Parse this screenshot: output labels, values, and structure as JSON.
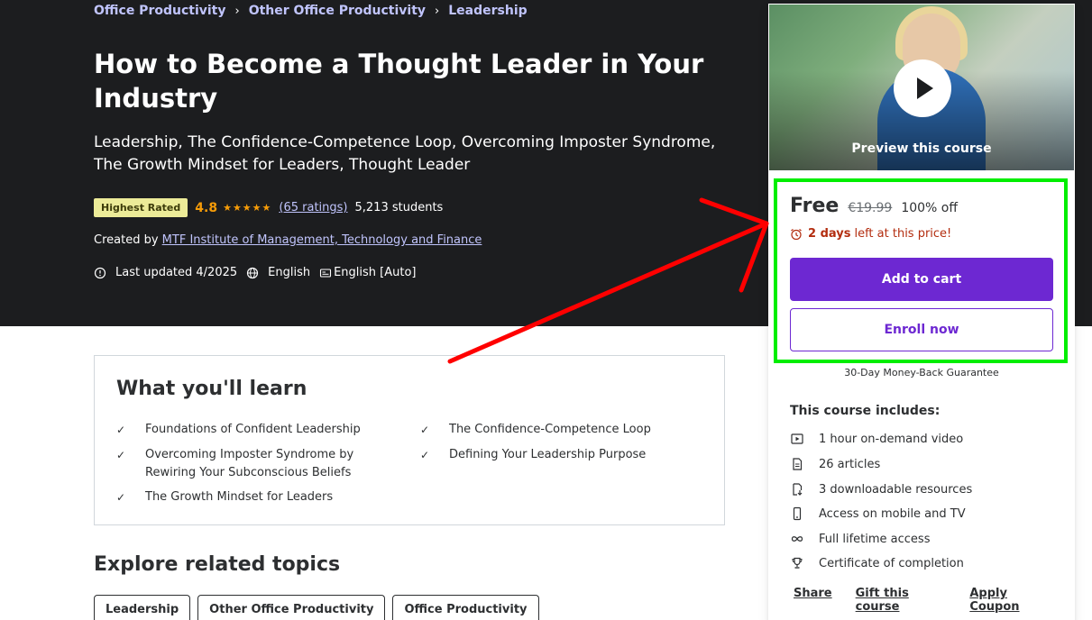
{
  "breadcrumbs": [
    "Office Productivity",
    "Other Office Productivity",
    "Leadership"
  ],
  "course": {
    "title": "How to Become a Thought Leader in Your Industry",
    "subtitle": "Leadership, The Confidence-Competence Loop, Overcoming Imposter Syndrome, The Growth Mindset for Leaders, Thought Leader",
    "badge": "Highest Rated",
    "rating": "4.8",
    "stars": 4.8,
    "ratings_count": "(65 ratings)",
    "students": "5,213 students",
    "created_by_label": "Created by",
    "creator": "MTF Institute of Management, Technology and Finance",
    "last_updated": "Last updated 4/2025",
    "language": "English",
    "captions": "English [Auto]"
  },
  "learn": {
    "heading": "What you'll learn",
    "items": [
      "Foundations of Confident Leadership",
      "The Confidence-Competence Loop",
      "Overcoming Imposter Syndrome by Rewiring Your Subconscious Beliefs",
      "Defining Your Leadership Purpose",
      "The Growth Mindset for Leaders"
    ]
  },
  "related": {
    "heading": "Explore related topics",
    "topics": [
      "Leadership",
      "Other Office Productivity",
      "Office Productivity"
    ]
  },
  "sidebar": {
    "preview_label": "Preview this course",
    "price": "Free",
    "original_price": "€19.99",
    "discount": "100% off",
    "timer_bold": "2 days",
    "timer_rest": "left at this price!",
    "add_to_cart": "Add to cart",
    "enroll_now": "Enroll now",
    "guarantee": "30-Day Money-Back Guarantee",
    "includes_title": "This course includes:",
    "includes": [
      {
        "icon": "video-icon",
        "text": "1 hour on-demand video"
      },
      {
        "icon": "article-icon",
        "text": "26 articles"
      },
      {
        "icon": "download-icon",
        "text": "3 downloadable resources"
      },
      {
        "icon": "mobile-icon",
        "text": "Access on mobile and TV"
      },
      {
        "icon": "infinity-icon",
        "text": "Full lifetime access"
      },
      {
        "icon": "trophy-icon",
        "text": "Certificate of completion"
      }
    ],
    "links": [
      "Share",
      "Gift this course",
      "Apply Coupon"
    ]
  },
  "colors": {
    "hero_bg": "#1c1d1f",
    "accent_purple": "#6d28d2",
    "link_lavender": "#c0c4fc",
    "star_orange": "#f69c08",
    "badge_yellow": "#eceb98",
    "timer_red": "#b32d0f",
    "highlight_green": "#00ee00",
    "annotation_red": "#ff0000"
  }
}
